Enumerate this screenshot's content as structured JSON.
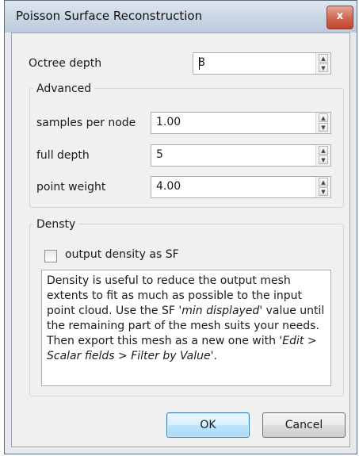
{
  "window": {
    "title": "Poisson Surface Reconstruction",
    "close_label": "x"
  },
  "octree": {
    "label": "Octree depth",
    "value": "8"
  },
  "advanced": {
    "title": "Advanced",
    "samples_label": "samples per node",
    "samples_value": "1.00",
    "full_depth_label": "full depth",
    "full_depth_value": "5",
    "point_weight_label": "point weight",
    "point_weight_value": "4.00"
  },
  "density": {
    "title": "Densty",
    "checkbox_label": "output density as SF",
    "checked": false,
    "info_line1": "Density is useful to reduce the output mesh extents to fit as much as possible to the input point cloud. Use the SF '",
    "info_italic1": "min displayed",
    "info_line2": "' value until the remaining part of the mesh suits your needs. Then export this mesh as a new one with '",
    "info_italic2": "Edit > Scalar fields > Filter by Value",
    "info_line3": "'."
  },
  "buttons": {
    "ok": "OK",
    "cancel": "Cancel"
  },
  "icons": {
    "up": "spin-up-icon",
    "down": "spin-down-icon",
    "close": "close-icon"
  }
}
